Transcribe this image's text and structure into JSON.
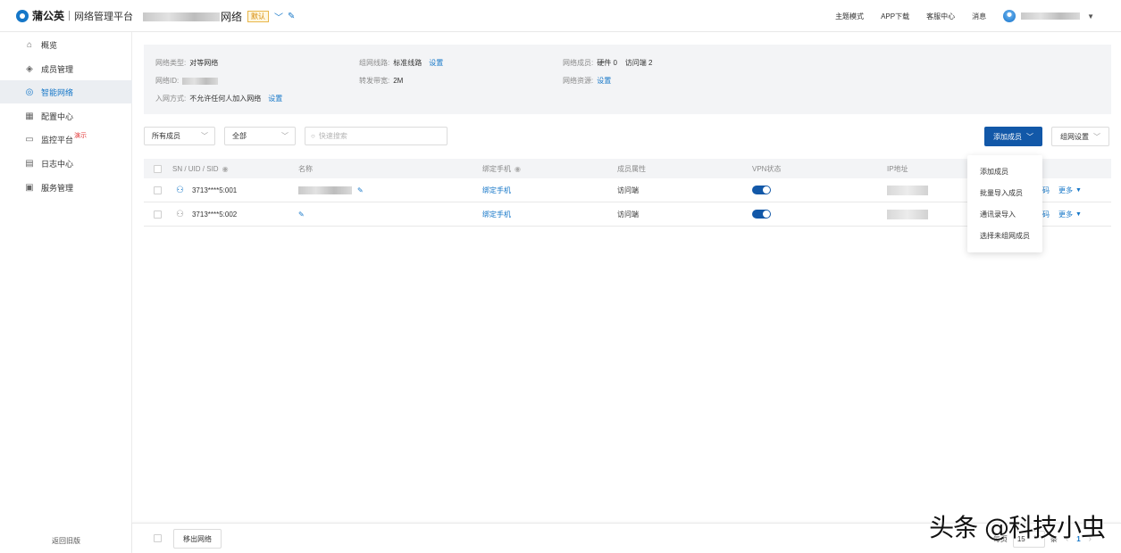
{
  "header": {
    "brand": "蒲公英",
    "subtitle": "网络管理平台",
    "network_name_suffix": "网络",
    "default_badge": "默认",
    "nav": [
      "主题模式",
      "APP下载",
      "客服中心",
      "消息"
    ]
  },
  "sidebar": {
    "items": [
      {
        "label": "概览",
        "icon": "home-icon"
      },
      {
        "label": "成员管理",
        "icon": "layers-icon"
      },
      {
        "label": "智能网络",
        "icon": "network-icon",
        "active": true
      },
      {
        "label": "配置中心",
        "icon": "grid-icon"
      },
      {
        "label": "监控平台",
        "icon": "monitor-icon",
        "badge": "演示"
      },
      {
        "label": "日志中心",
        "icon": "clipboard-icon"
      },
      {
        "label": "服务管理",
        "icon": "document-icon"
      }
    ],
    "back_old": "返回旧版"
  },
  "info": {
    "network_type_label": "网络类型:",
    "network_type_value": "对等网络",
    "line_label": "组网线路:",
    "line_value": "标准线路",
    "line_link": "设置",
    "members_label": "网络成员:",
    "members_value": "硬件 0    访问端 2",
    "network_id_label": "网络ID:",
    "bandwidth_label": "转发带宽:",
    "bandwidth_value": "2M",
    "resources_label": "网络资源:",
    "resources_link": "设置",
    "join_label": "入网方式:",
    "join_value": "不允许任何人加入网络",
    "join_link": "设置"
  },
  "filters": {
    "members": "所有成员",
    "status": "全部",
    "search_placeholder": "快速搜索"
  },
  "buttons": {
    "add_member": "添加成员",
    "network_settings": "组网设置",
    "remove": "移出网络"
  },
  "table": {
    "columns": [
      "SN / UID / SID",
      "名称",
      "绑定手机",
      "成员属性",
      "VPN状态",
      "IP地址"
    ],
    "rows": [
      {
        "id": "3713****5:001",
        "bind": "绑定手机",
        "attr": "访问端",
        "op_partial": "码",
        "more": "更多"
      },
      {
        "id": "3713****5:002",
        "bind": "绑定手机",
        "attr": "访问端",
        "op_partial": "码",
        "more": "更多"
      }
    ]
  },
  "dropdown": {
    "items": [
      "添加成员",
      "批量导入成员",
      "通讯录导入",
      "选择未组网成员"
    ]
  },
  "pagination": {
    "per_page_label": "每页",
    "page_size": "15",
    "unit": "条",
    "current_page": "1"
  },
  "watermark": "头条 @科技小虫",
  "colors": {
    "accent": "#1677c8",
    "primary_button": "#1258a8",
    "sidebar_active_bg": "#ebeef2"
  }
}
